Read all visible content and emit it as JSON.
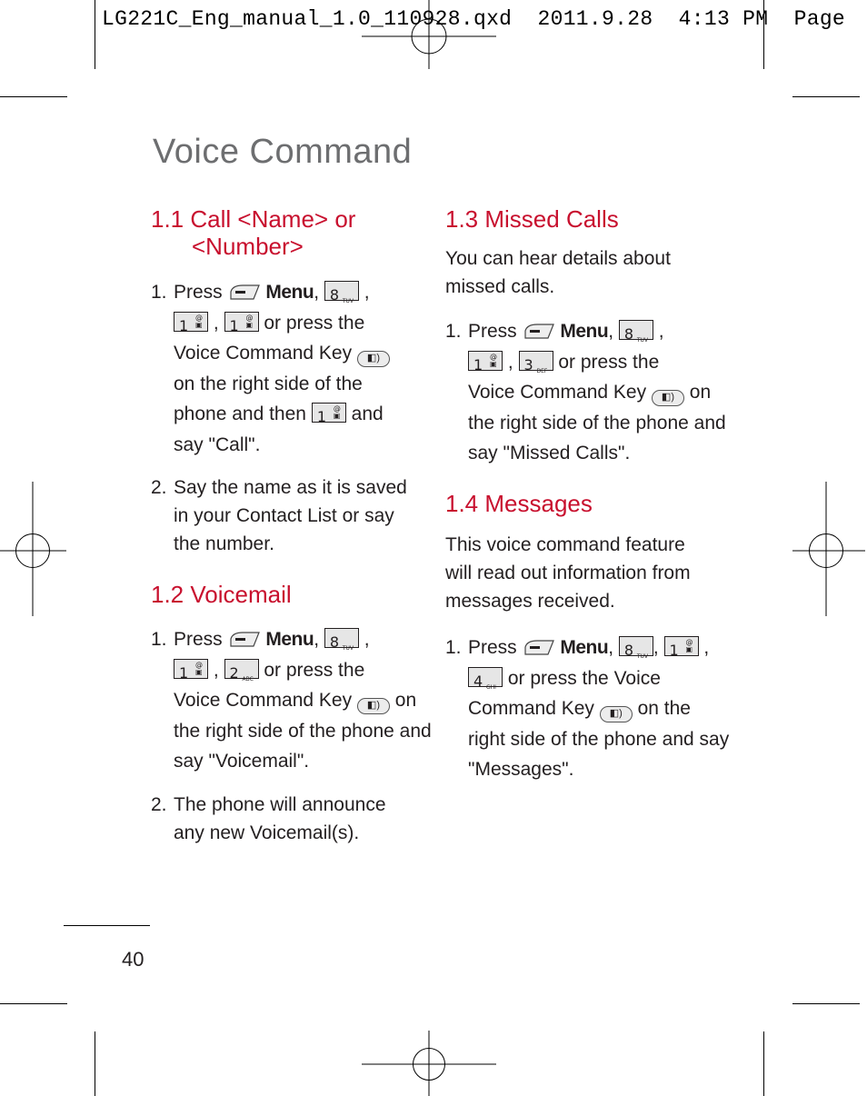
{
  "slug": {
    "filename": "LG221C_Eng_manual_1.0_110928.qxd",
    "date": "2011.9.28",
    "time": "4:13",
    "ampm": "PM",
    "page_word": "Page"
  },
  "title": "Voice Command",
  "sections": [
    {
      "heading_line1": "1.1 Call <Name> or",
      "heading_line2": "<Number>",
      "steps": [
        {
          "num": "1.",
          "press": "Press",
          "menu": "Menu",
          "keys": [
            "8",
            "1",
            "1"
          ],
          "lines": [
            "or press the",
            "Voice Command Key",
            "on the right side of the",
            "phone and then",
            "and",
            "say \"Call\"."
          ]
        },
        {
          "num": "2.",
          "lines": [
            "Say the name as it is saved",
            "in your Contact List or say",
            "the number."
          ]
        }
      ]
    },
    {
      "heading": "1.2 Voicemail",
      "steps": [
        {
          "num": "1.",
          "press": "Press",
          "menu": "Menu",
          "keys": [
            "8",
            "1",
            "2"
          ],
          "lines": [
            "or press the",
            "Voice Command Key",
            "on",
            "the right side of the phone and",
            "say \"Voicemail\"."
          ]
        },
        {
          "num": "2.",
          "lines": [
            "The phone will announce",
            "any new Voicemail(s)."
          ]
        }
      ]
    },
    {
      "heading": "1.3 Missed Calls",
      "intro": [
        "You can hear details about",
        "missed calls."
      ],
      "steps": [
        {
          "num": "1.",
          "press": "Press",
          "menu": "Menu",
          "keys": [
            "8",
            "1",
            "3"
          ],
          "lines": [
            "or press the",
            "Voice Command Key",
            "on",
            "the right side of the phone and",
            "say \"Missed Calls\"."
          ]
        }
      ]
    },
    {
      "heading": "1.4 Messages",
      "intro": [
        "This voice command feature",
        "will read out information from",
        "messages received."
      ],
      "steps": [
        {
          "num": "1.",
          "press": "Press",
          "menu": "Menu",
          "keys": [
            "8",
            "1",
            "4"
          ],
          "lines": [
            "or press the Voice",
            "Command Key",
            "on the",
            "right side of the phone and say",
            "\"Messages\"."
          ]
        }
      ]
    }
  ],
  "key_letters": {
    "1": "",
    "2": "ABC",
    "3": "DEF",
    "4": "GHI",
    "8": "TUV"
  },
  "page_number": "40",
  "colors": {
    "heading": "#c8102e",
    "title": "#6d6e70",
    "body": "#231f20"
  }
}
